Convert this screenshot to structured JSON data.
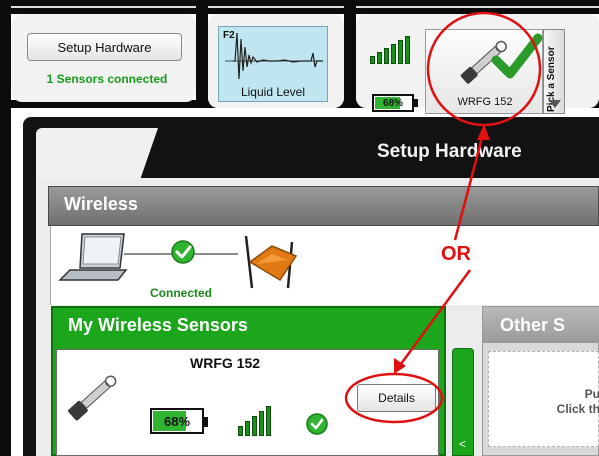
{
  "top_bar": {
    "setup_hardware_button": "Setup Hardware",
    "sensors_connected": "1 Sensors connected",
    "liquid_level_tile": {
      "channel": "F2",
      "label": "Liquid Level"
    },
    "sensor_tile": {
      "battery": "68%",
      "name": "WRFG 152",
      "icon": "sensor-probe-icon",
      "check_icon": "checkmark-icon"
    },
    "pick_sensor_tab": "Pick a Sensor"
  },
  "dialog": {
    "title": "Setup Hardware",
    "wireless": {
      "header": "Wireless",
      "status": "Connected",
      "icons": [
        "laptop-icon",
        "connected-check-icon",
        "receiver-icon"
      ]
    },
    "my_wireless_sensors": {
      "header": "My Wireless Sensors",
      "sensor": {
        "name": "WRFG 152",
        "battery": "68%",
        "details_button": "Details",
        "icons": [
          "sensor-probe-icon",
          "signal-icon",
          "ok-check-icon"
        ]
      }
    },
    "other_sensors": {
      "header": "Other S",
      "line1": "Pu",
      "line2": "Click th"
    }
  },
  "annotation": {
    "text": "OR",
    "color": "#e01010"
  },
  "colors": {
    "accent_green": "#1ca61c",
    "header_gray": "#808080",
    "annotation_red": "#e01010",
    "tile_blue": "#bfe6f0"
  }
}
